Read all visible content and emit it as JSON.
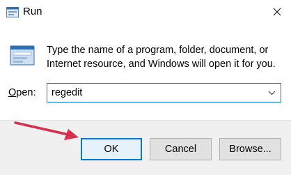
{
  "window": {
    "title": "Run",
    "close_glyph": "✕"
  },
  "dialog": {
    "description": "Type the name of a program, folder, document, or Internet resource, and Windows will open it for you.",
    "open_label_mnemonic": "O",
    "open_label_rest": "pen:",
    "open_value": "regedit"
  },
  "buttons": {
    "ok": "OK",
    "cancel": "Cancel",
    "browse": "Browse..."
  },
  "colors": {
    "accent": "#0078d7",
    "annotation_arrow": "#d6304e"
  },
  "icons": {
    "title": "run-icon",
    "main": "run-icon",
    "close": "close-icon",
    "dropdown": "chevron-down-icon"
  }
}
